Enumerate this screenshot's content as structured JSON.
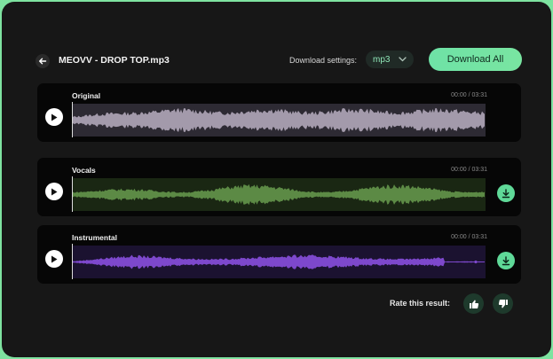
{
  "file": {
    "title": "MEOVV - DROP TOP.mp3"
  },
  "settings": {
    "label": "Download settings:",
    "format": "mp3"
  },
  "actions": {
    "download_all": "Download All"
  },
  "tracks": [
    {
      "label": "Original",
      "time": "00:00 / 03:31",
      "color": "#a39aab",
      "bg": "#2d2a33",
      "has_download": false
    },
    {
      "label": "Vocals",
      "time": "00:00 / 03:31",
      "color": "#5c8a45",
      "bg": "#1a2713",
      "has_download": true
    },
    {
      "label": "Instrumental",
      "time": "00:00 / 03:31",
      "color": "#7d48cc",
      "bg": "#1b1230",
      "has_download": true
    }
  ],
  "rating": {
    "label": "Rate this result:"
  },
  "colors": {
    "accent": "#6ee2a6",
    "frame_border": "#7ee3a0",
    "background": "#171717"
  },
  "icons": {
    "back": "arrow-left-icon",
    "dropdown": "chevron-down-icon",
    "play": "play-icon",
    "download": "download-icon",
    "thumbs_up": "thumbs-up-icon",
    "thumbs_down": "thumbs-down-icon"
  }
}
